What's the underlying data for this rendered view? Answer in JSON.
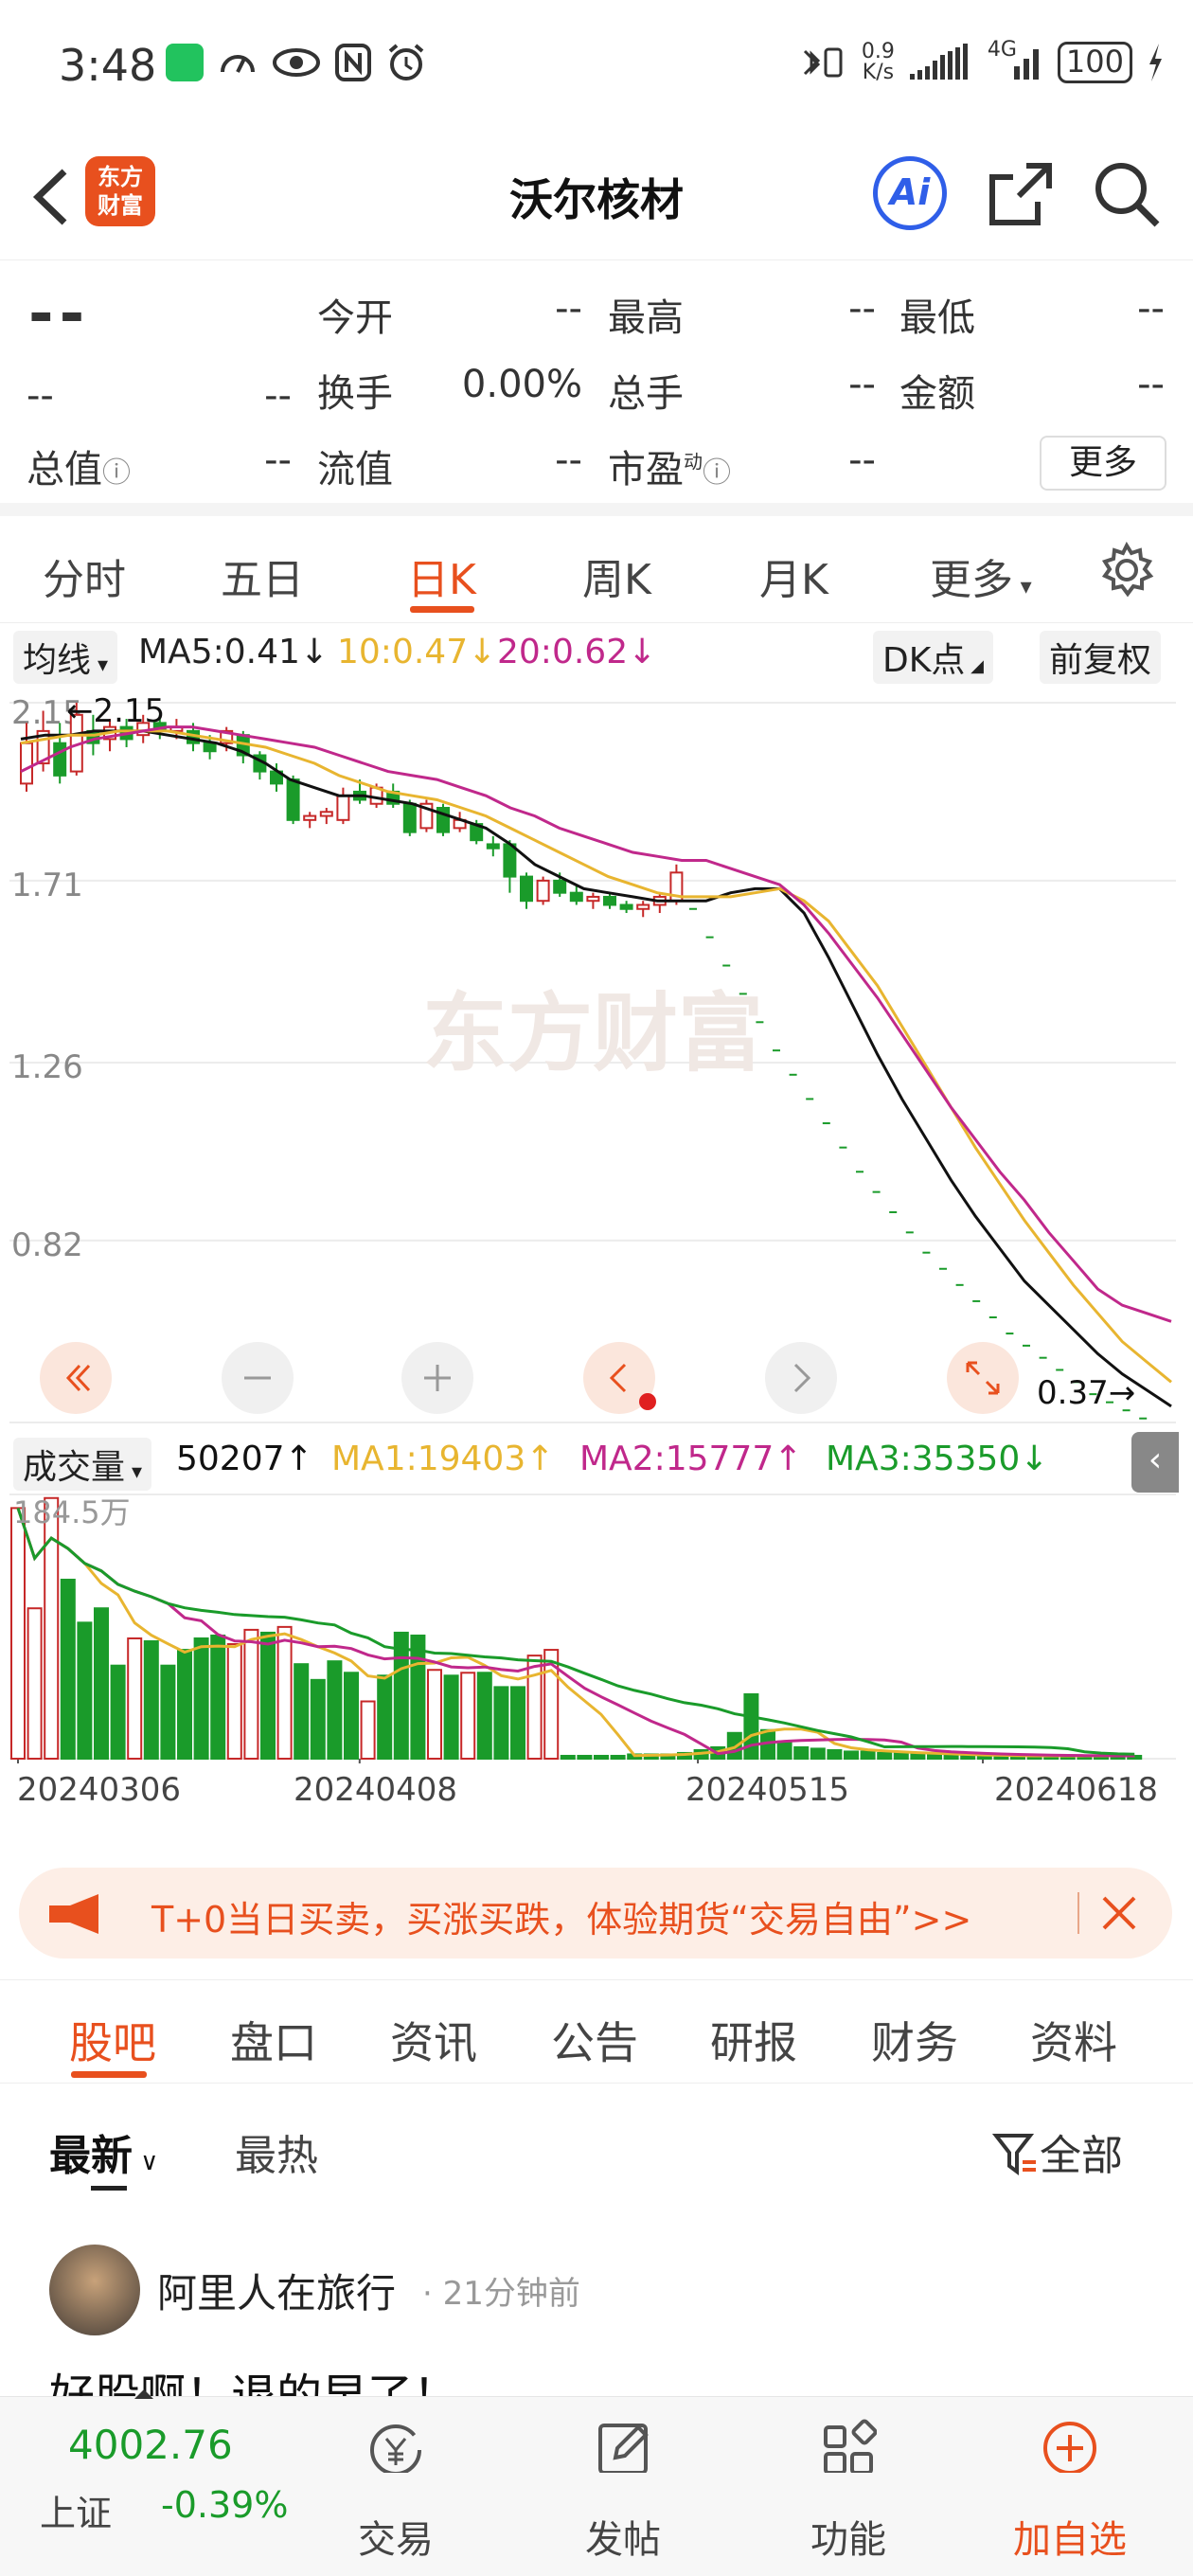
{
  "status_bar": {
    "time": "3:48",
    "net_speed_value": "0.9",
    "net_speed_unit": "K/s",
    "network": "4G",
    "battery": "100"
  },
  "header": {
    "back_icon": "chevron-left-icon",
    "logo_line1": "东方",
    "logo_line2": "财富",
    "title": "沃尔核材",
    "ai_label": "Ai",
    "share_icon": "share-icon",
    "search_icon": "search-icon"
  },
  "quote": {
    "price": "--",
    "change": "--",
    "change_pct": "--",
    "open_label": "今开",
    "open_value": "--",
    "high_label": "最高",
    "high_value": "--",
    "low_label": "最低",
    "low_value": "--",
    "turnover_label": "换手",
    "turnover_value": "0.00%",
    "volume_label": "总手",
    "volume_value": "--",
    "amount_label": "金额",
    "amount_value": "--",
    "mcap_label": "总值",
    "mcap_value": "--",
    "float_label": "流值",
    "float_value": "--",
    "pe_label": "市盈",
    "pe_sup": "动",
    "pe_value": "--",
    "more_button": "更多"
  },
  "period_tabs": {
    "items": [
      "分时",
      "五日",
      "日K",
      "周K",
      "月K",
      "更多"
    ],
    "active": "日K",
    "settings_icon": "gear-icon"
  },
  "chart_toolbar": {
    "ma_select": "均线",
    "ma5": "MA5:0.41",
    "ma10": "10:0.47",
    "ma20": "20:0.62",
    "dk_button": "DK点",
    "adjust_button": "前复权"
  },
  "chart_controls": [
    "rewind-icon",
    "zoom-out-icon",
    "zoom-in-icon",
    "step-left-icon",
    "step-right-icon",
    "fullscreen-icon"
  ],
  "chart_data": [
    {
      "type": "candlestick",
      "watermark": "东方财富",
      "y_ticks": [
        "2.15",
        "1.71",
        "1.26",
        "0.82",
        "0.37"
      ],
      "ylim": [
        0.37,
        2.15
      ],
      "high_marker": "2.15",
      "low_marker": "0.37",
      "candles": [
        {
          "o": 1.95,
          "c": 2.05,
          "h": 2.1,
          "l": 1.93,
          "up": true
        },
        {
          "o": 2.0,
          "c": 2.08,
          "h": 2.13,
          "l": 1.98,
          "up": true
        },
        {
          "o": 2.05,
          "c": 1.97,
          "h": 2.1,
          "l": 1.95,
          "up": false
        },
        {
          "o": 1.98,
          "c": 2.12,
          "h": 2.15,
          "l": 1.97,
          "up": true
        },
        {
          "o": 2.08,
          "c": 2.05,
          "h": 2.12,
          "l": 2.02,
          "up": false
        },
        {
          "o": 2.06,
          "c": 2.09,
          "h": 2.11,
          "l": 2.03,
          "up": true
        },
        {
          "o": 2.09,
          "c": 2.06,
          "h": 2.11,
          "l": 2.04,
          "up": false
        },
        {
          "o": 2.07,
          "c": 2.1,
          "h": 2.12,
          "l": 2.05,
          "up": true
        },
        {
          "o": 2.1,
          "c": 2.08,
          "h": 2.12,
          "l": 2.06,
          "up": false
        },
        {
          "o": 2.08,
          "c": 2.09,
          "h": 2.11,
          "l": 2.06,
          "up": true
        },
        {
          "o": 2.08,
          "c": 2.05,
          "h": 2.1,
          "l": 2.03,
          "up": false
        },
        {
          "o": 2.05,
          "c": 2.03,
          "h": 2.07,
          "l": 2.01,
          "up": false
        },
        {
          "o": 2.05,
          "c": 2.08,
          "h": 2.09,
          "l": 2.03,
          "up": true
        },
        {
          "o": 2.07,
          "c": 2.02,
          "h": 2.08,
          "l": 2.0,
          "up": false
        },
        {
          "o": 2.02,
          "c": 1.98,
          "h": 2.03,
          "l": 1.96,
          "up": false
        },
        {
          "o": 1.98,
          "c": 1.95,
          "h": 2.0,
          "l": 1.93,
          "up": false
        },
        {
          "o": 1.96,
          "c": 1.86,
          "h": 1.97,
          "l": 1.85,
          "up": false
        },
        {
          "o": 1.86,
          "c": 1.87,
          "h": 1.88,
          "l": 1.84,
          "up": true
        },
        {
          "o": 1.87,
          "c": 1.88,
          "h": 1.89,
          "l": 1.85,
          "up": true
        },
        {
          "o": 1.86,
          "c": 1.92,
          "h": 1.94,
          "l": 1.85,
          "up": true
        },
        {
          "o": 1.93,
          "c": 1.91,
          "h": 1.96,
          "l": 1.9,
          "up": false
        },
        {
          "o": 1.9,
          "c": 1.94,
          "h": 1.95,
          "l": 1.89,
          "up": true
        },
        {
          "o": 1.93,
          "c": 1.9,
          "h": 1.95,
          "l": 1.89,
          "up": false
        },
        {
          "o": 1.9,
          "c": 1.83,
          "h": 1.91,
          "l": 1.82,
          "up": false
        },
        {
          "o": 1.84,
          "c": 1.9,
          "h": 1.91,
          "l": 1.83,
          "up": true
        },
        {
          "o": 1.89,
          "c": 1.83,
          "h": 1.9,
          "l": 1.82,
          "up": false
        },
        {
          "o": 1.84,
          "c": 1.86,
          "h": 1.88,
          "l": 1.83,
          "up": true
        },
        {
          "o": 1.85,
          "c": 1.81,
          "h": 1.86,
          "l": 1.8,
          "up": false
        },
        {
          "o": 1.8,
          "c": 1.79,
          "h": 1.82,
          "l": 1.77,
          "up": false
        },
        {
          "o": 1.8,
          "c": 1.72,
          "h": 1.81,
          "l": 1.68,
          "up": false
        },
        {
          "o": 1.72,
          "c": 1.66,
          "h": 1.73,
          "l": 1.64,
          "up": false
        },
        {
          "o": 1.66,
          "c": 1.71,
          "h": 1.72,
          "l": 1.65,
          "up": true
        },
        {
          "o": 1.71,
          "c": 1.68,
          "h": 1.73,
          "l": 1.67,
          "up": false
        },
        {
          "o": 1.68,
          "c": 1.66,
          "h": 1.7,
          "l": 1.65,
          "up": false
        },
        {
          "o": 1.66,
          "c": 1.67,
          "h": 1.68,
          "l": 1.64,
          "up": true
        },
        {
          "o": 1.67,
          "c": 1.65,
          "h": 1.68,
          "l": 1.64,
          "up": false
        },
        {
          "o": 1.65,
          "c": 1.64,
          "h": 1.66,
          "l": 1.63,
          "up": false
        },
        {
          "o": 1.64,
          "c": 1.65,
          "h": 1.66,
          "l": 1.62,
          "up": true
        },
        {
          "o": 1.65,
          "c": 1.67,
          "h": 1.68,
          "l": 1.63,
          "up": true
        },
        {
          "o": 1.66,
          "c": 1.73,
          "h": 1.75,
          "l": 1.65,
          "up": true
        }
      ],
      "limit_down_dashes": [
        1.64,
        1.57,
        1.5,
        1.43,
        1.36,
        1.29,
        1.23,
        1.17,
        1.11,
        1.05,
        0.99,
        0.94,
        0.89,
        0.84,
        0.79,
        0.75,
        0.71,
        0.67,
        0.63,
        0.59,
        0.56,
        0.53,
        0.5,
        0.47,
        0.44,
        0.42,
        0.4,
        0.38
      ],
      "ma_lines": [
        {
          "name": "MA5",
          "color": "#111111",
          "values": [
            2.06,
            2.07,
            2.07,
            2.08,
            2.08,
            2.08,
            2.07,
            2.06,
            2.05,
            2.03,
            2.0,
            1.96,
            1.94,
            1.92,
            1.92,
            1.91,
            1.9,
            1.88,
            1.86,
            1.84,
            1.8,
            1.75,
            1.72,
            1.69,
            1.68,
            1.67,
            1.66,
            1.66,
            1.66,
            1.68,
            1.69,
            1.69,
            1.63,
            1.52,
            1.4,
            1.28,
            1.17,
            1.07,
            0.97,
            0.88,
            0.8,
            0.72,
            0.66,
            0.6,
            0.54,
            0.49,
            0.45,
            0.41
          ]
        },
        {
          "name": "MA10",
          "color": "#e8b530",
          "values": [
            2.05,
            2.06,
            2.07,
            2.07,
            2.08,
            2.08,
            2.08,
            2.07,
            2.06,
            2.05,
            2.04,
            2.02,
            2.0,
            1.97,
            1.95,
            1.93,
            1.92,
            1.91,
            1.89,
            1.87,
            1.84,
            1.81,
            1.78,
            1.75,
            1.72,
            1.7,
            1.68,
            1.67,
            1.67,
            1.67,
            1.68,
            1.69,
            1.66,
            1.61,
            1.53,
            1.45,
            1.35,
            1.25,
            1.15,
            1.05,
            0.96,
            0.87,
            0.79,
            0.71,
            0.64,
            0.57,
            0.52,
            0.47
          ]
        },
        {
          "name": "MA20",
          "color": "#c0288b",
          "values": [
            1.98,
            2.01,
            2.04,
            2.06,
            2.07,
            2.08,
            2.09,
            2.09,
            2.08,
            2.07,
            2.06,
            2.05,
            2.04,
            2.02,
            2.0,
            1.98,
            1.97,
            1.96,
            1.94,
            1.92,
            1.89,
            1.87,
            1.84,
            1.82,
            1.8,
            1.78,
            1.77,
            1.76,
            1.76,
            1.74,
            1.72,
            1.7,
            1.65,
            1.58,
            1.5,
            1.42,
            1.33,
            1.24,
            1.15,
            1.07,
            0.99,
            0.92,
            0.84,
            0.77,
            0.7,
            0.66,
            0.64,
            0.62
          ]
        }
      ]
    },
    {
      "type": "bar",
      "label": "成交量",
      "select_label": "成交量",
      "current": "50207",
      "ma1": "MA1:19403",
      "ma2": "MA2:15777",
      "ma3": "MA3:35350",
      "max_label": "184.5万",
      "ylim": [
        0,
        184.5
      ],
      "bars": [
        {
          "v": 175,
          "up": true
        },
        {
          "v": 105,
          "up": true
        },
        {
          "v": 182,
          "up": true
        },
        {
          "v": 125,
          "up": false
        },
        {
          "v": 95,
          "up": false
        },
        {
          "v": 105,
          "up": false
        },
        {
          "v": 65,
          "up": false
        },
        {
          "v": 84,
          "up": true
        },
        {
          "v": 82,
          "up": false
        },
        {
          "v": 65,
          "up": false
        },
        {
          "v": 76,
          "up": false
        },
        {
          "v": 84,
          "up": false
        },
        {
          "v": 86,
          "up": false
        },
        {
          "v": 80,
          "up": true
        },
        {
          "v": 90,
          "up": true
        },
        {
          "v": 88,
          "up": false
        },
        {
          "v": 92,
          "up": true
        },
        {
          "v": 66,
          "up": false
        },
        {
          "v": 55,
          "up": false
        },
        {
          "v": 68,
          "up": false
        },
        {
          "v": 60,
          "up": false
        },
        {
          "v": 40,
          "up": true
        },
        {
          "v": 58,
          "up": false
        },
        {
          "v": 88,
          "up": false
        },
        {
          "v": 86,
          "up": false
        },
        {
          "v": 62,
          "up": true
        },
        {
          "v": 58,
          "up": false
        },
        {
          "v": 60,
          "up": true
        },
        {
          "v": 60,
          "up": false
        },
        {
          "v": 50,
          "up": false
        },
        {
          "v": 50,
          "up": false
        },
        {
          "v": 72,
          "up": true
        },
        {
          "v": 76,
          "up": true
        },
        {
          "v": 2,
          "up": false
        },
        {
          "v": 2,
          "up": false
        },
        {
          "v": 2,
          "up": false
        },
        {
          "v": 2,
          "up": false
        },
        {
          "v": 3,
          "up": false
        },
        {
          "v": 3,
          "up": false
        },
        {
          "v": 3,
          "up": false
        },
        {
          "v": 4,
          "up": false
        },
        {
          "v": 6,
          "up": false
        },
        {
          "v": 8,
          "up": false
        },
        {
          "v": 18,
          "up": false
        },
        {
          "v": 45,
          "up": false
        },
        {
          "v": 20,
          "up": false
        },
        {
          "v": 12,
          "up": false
        },
        {
          "v": 8,
          "up": false
        },
        {
          "v": 7,
          "up": false
        },
        {
          "v": 6,
          "up": false
        },
        {
          "v": 5,
          "up": false
        },
        {
          "v": 5,
          "up": false
        },
        {
          "v": 4,
          "up": false
        },
        {
          "v": 4,
          "up": false
        },
        {
          "v": 3,
          "up": false
        },
        {
          "v": 3,
          "up": false
        },
        {
          "v": 3,
          "up": false
        },
        {
          "v": 2,
          "up": false
        },
        {
          "v": 2,
          "up": false
        },
        {
          "v": 2,
          "up": false
        },
        {
          "v": 2,
          "up": false
        },
        {
          "v": 2,
          "up": false
        },
        {
          "v": 2,
          "up": false
        },
        {
          "v": 2,
          "up": false
        },
        {
          "v": 2,
          "up": false
        },
        {
          "v": 2,
          "up": false
        },
        {
          "v": 2,
          "up": false
        },
        {
          "v": 2,
          "up": false
        }
      ],
      "x_ticks": [
        "20240306",
        "20240408",
        "20240515",
        "20240618"
      ]
    }
  ],
  "banner": {
    "icon": "megaphone-icon",
    "text": "T+0当日买卖，买涨买跌，体验期货“交易自由”>>",
    "close_icon": "close-icon"
  },
  "sub_tabs": {
    "items": [
      "股吧",
      "盘口",
      "资讯",
      "公告",
      "研报",
      "财务",
      "资料"
    ],
    "active": "股吧"
  },
  "sort": {
    "latest": "最新",
    "hot": "最热",
    "filter_label": "全部",
    "filter_icon": "filter-icon"
  },
  "post": {
    "author": "阿里人在旅行",
    "time": "21分钟前",
    "content": "好股啊！退的早了！"
  },
  "bottom_nav": {
    "index_value": "4002.76",
    "index_name": "上证",
    "index_change": "-0.39%",
    "items": [
      {
        "label": "交易",
        "icon": "yen-circle-icon"
      },
      {
        "label": "发帖",
        "icon": "edit-icon"
      },
      {
        "label": "功能",
        "icon": "grid-icon"
      },
      {
        "label": "加自选",
        "icon": "add-circle-icon"
      }
    ]
  },
  "colors": {
    "accent": "#e8501e",
    "up": "#c62828",
    "down": "#1a9b2a",
    "ma5": "#111111",
    "ma10": "#e8b530",
    "ma20": "#c0288b"
  }
}
